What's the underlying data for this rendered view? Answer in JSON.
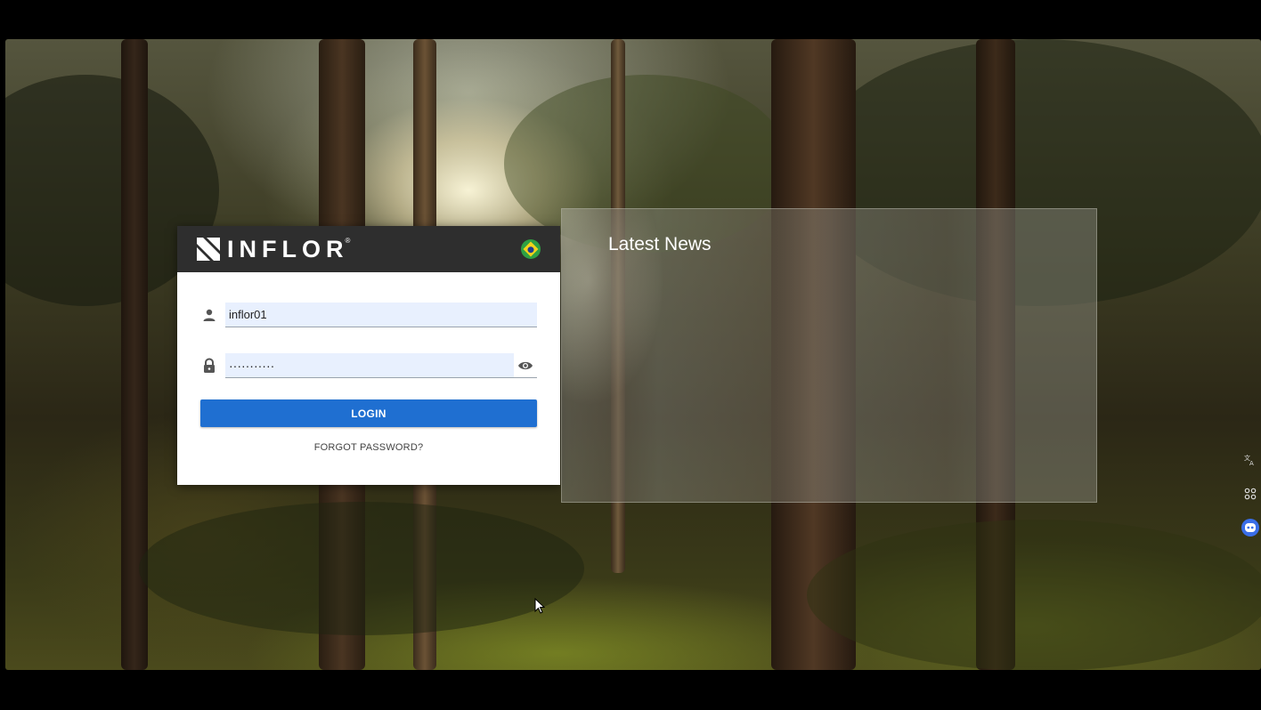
{
  "brand": {
    "name": "INFLOR",
    "registered_mark": "®"
  },
  "login": {
    "username_value": "inflor01",
    "password_masked": "···········",
    "login_label": "LOGIN",
    "forgot_label": "FORGOT PASSWORD?"
  },
  "news": {
    "title": "Latest News"
  },
  "icons": {
    "language": "brazil-flag-icon",
    "user": "person-icon",
    "password": "lock-icon",
    "toggle_visibility": "eye-icon",
    "side_translate": "translate-icon",
    "side_grid": "grid-icon",
    "side_assistant": "assistant-bot-icon"
  },
  "colors": {
    "header_bg": "#2e2e2e",
    "login_button": "#1f6fd1",
    "input_bg": "#e8f0fe",
    "flag_green": "#2ea043",
    "flag_yellow": "#f2d21b",
    "flag_blue": "#1f3c8f"
  }
}
